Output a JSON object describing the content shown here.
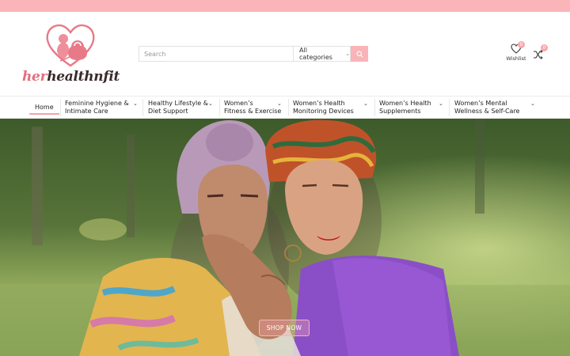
{
  "brand": {
    "logo_text_pink": "her",
    "logo_text_dark": "healthnfit",
    "accent_color": "#f9b5b8",
    "logo_color": "#e36f7e"
  },
  "search": {
    "placeholder": "Search",
    "category_selected": "All categories",
    "button_icon": "search-icon"
  },
  "header_actions": {
    "wishlist_label": "Wishlist",
    "wishlist_count": "0",
    "compare_count": "0",
    "wishlist_icon": "heart-icon",
    "compare_icon": "shuffle-icon"
  },
  "nav": {
    "items": [
      {
        "line1": "Home",
        "line2": ""
      },
      {
        "line1": "Feminine Hygiene &",
        "line2": "Intimate Care"
      },
      {
        "line1": "Healthy Lifestyle &",
        "line2": "Diet Support"
      },
      {
        "line1": "Women’s",
        "line2": "Fitness & Exercise"
      },
      {
        "line1": "Women’s Health",
        "line2": "Monitoring Devices"
      },
      {
        "line1": "Women’s Health",
        "line2": "Supplements"
      },
      {
        "line1": "Women’s Mental",
        "line2": "Wellness & Self-Care"
      }
    ]
  },
  "hero": {
    "cta_label": "SHOP NOW"
  }
}
